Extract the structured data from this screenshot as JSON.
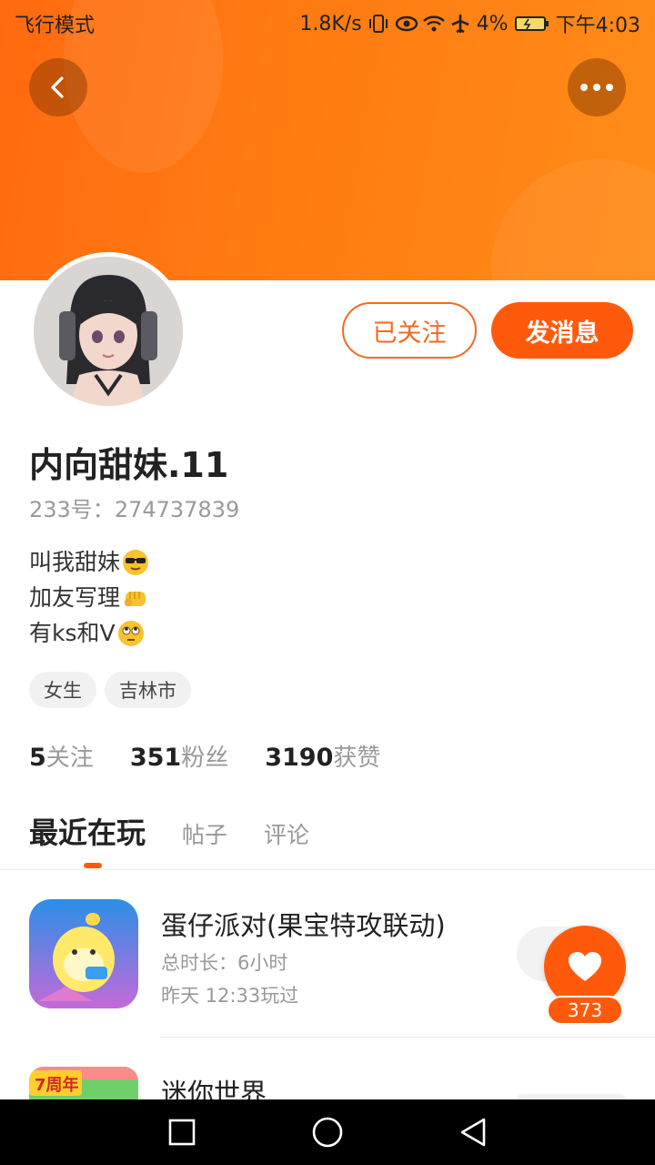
{
  "status_bar": {
    "left_text": "飞行模式",
    "net_speed": "1.8K/s",
    "battery": "4%",
    "time": "下午4:03",
    "icons": [
      "vibrate-icon",
      "eye-icon",
      "wifi-icon",
      "airplane-icon",
      "battery-icon"
    ]
  },
  "header": {
    "back_icon": "chevron-left-icon",
    "more_icon": "more-dots-icon",
    "banner_color": "#ff7a12"
  },
  "profile": {
    "follow_state_label": "已关注",
    "message_label": "发消息",
    "username": "内向甜妹.11",
    "id_label": "233号：",
    "id_value": "274737839",
    "bio": [
      {
        "text": "叫我甜妹",
        "emoji": "sunglasses-emoji"
      },
      {
        "text": "加友写理",
        "emoji": "fist-emoji"
      },
      {
        "text": "有ks和V",
        "emoji": "eye-roll-emoji"
      }
    ],
    "tags": [
      "女生",
      "吉林市"
    ],
    "stats": [
      {
        "value": "5",
        "label": "关注"
      },
      {
        "value": "351",
        "label": "粉丝"
      },
      {
        "value": "3190",
        "label": "获赞"
      }
    ]
  },
  "tabs": [
    {
      "label": "最近在玩",
      "active": true
    },
    {
      "label": "帖子",
      "active": false
    },
    {
      "label": "评论",
      "active": false
    }
  ],
  "games": [
    {
      "title": "蛋仔派对(果宝特攻联动)",
      "duration": "总时长：6小时",
      "last_played": "昨天 12:33玩过"
    },
    {
      "title": "迷你世界",
      "badge_text": "7周年"
    }
  ],
  "floating": {
    "heart_icon": "heart-icon",
    "like_count": "373"
  },
  "accent_color": "#ff5a0c",
  "nav": [
    "square-icon",
    "circle-icon",
    "triangle-back-icon"
  ]
}
